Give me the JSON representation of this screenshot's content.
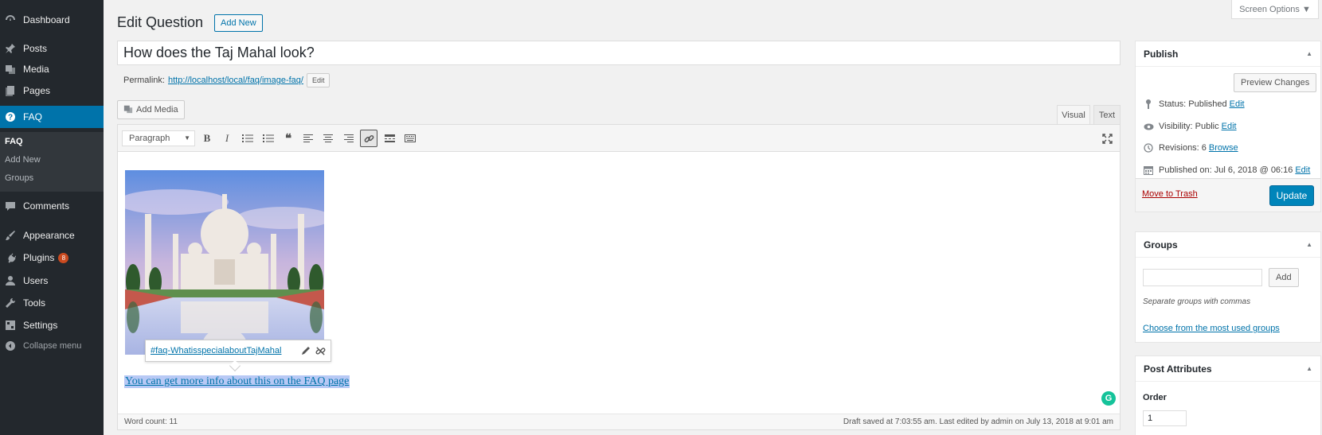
{
  "sidebar": {
    "items": [
      {
        "label": "Dashboard",
        "icon": "dashboard-icon"
      },
      {
        "label": "Posts",
        "icon": "pin-icon"
      },
      {
        "label": "Media",
        "icon": "media-icon"
      },
      {
        "label": "Pages",
        "icon": "pages-icon"
      },
      {
        "label": "FAQ",
        "icon": "question-icon"
      },
      {
        "label": "Comments",
        "icon": "comment-icon"
      },
      {
        "label": "Appearance",
        "icon": "brush-icon"
      },
      {
        "label": "Plugins",
        "icon": "plug-icon",
        "badge": "8"
      },
      {
        "label": "Users",
        "icon": "users-icon"
      },
      {
        "label": "Tools",
        "icon": "wrench-icon"
      },
      {
        "label": "Settings",
        "icon": "settings-icon"
      },
      {
        "label": "Collapse menu",
        "icon": "collapse-icon"
      }
    ],
    "faq_submenu": [
      "FAQ",
      "Add New",
      "Groups"
    ]
  },
  "header": {
    "screen_options": "Screen Options ▼",
    "title": "Edit Question",
    "add_new": "Add New"
  },
  "post": {
    "title": "How does the Taj Mahal look?",
    "permalink_label": "Permalink:",
    "permalink_url": "http://localhost/local/faq/image-faq/",
    "permalink_edit": "Edit"
  },
  "editor": {
    "add_media": "Add Media",
    "tabs": {
      "visual": "Visual",
      "text": "Text"
    },
    "format": "Paragraph",
    "link_popover": "#faq-WhatisspecialaboutTajMahal",
    "content_link": "You can get more info about this on the FAQ page",
    "word_count": "Word count: 11",
    "draft_status": "Draft saved at 7:03:55 am. Last edited by admin on July 13, 2018 at 9:01 am",
    "grammarly": "G"
  },
  "publish": {
    "title": "Publish",
    "preview": "Preview Changes",
    "status_label": "Status: Published",
    "visibility_label": "Visibility: Public",
    "revisions_label": "Revisions: 6",
    "published_label": "Published on: Jul 6, 2018 @ 06:16",
    "edit": "Edit",
    "browse": "Browse",
    "trash": "Move to Trash",
    "update": "Update"
  },
  "groups": {
    "title": "Groups",
    "add": "Add",
    "hint": "Separate groups with commas",
    "choose": "Choose from the most used groups"
  },
  "attributes": {
    "title": "Post Attributes",
    "order_label": "Order",
    "order_value": "1"
  },
  "colors": {
    "sidebar_bg": "#23282d",
    "accent": "#0073aa",
    "primary_button": "#0085ba"
  }
}
